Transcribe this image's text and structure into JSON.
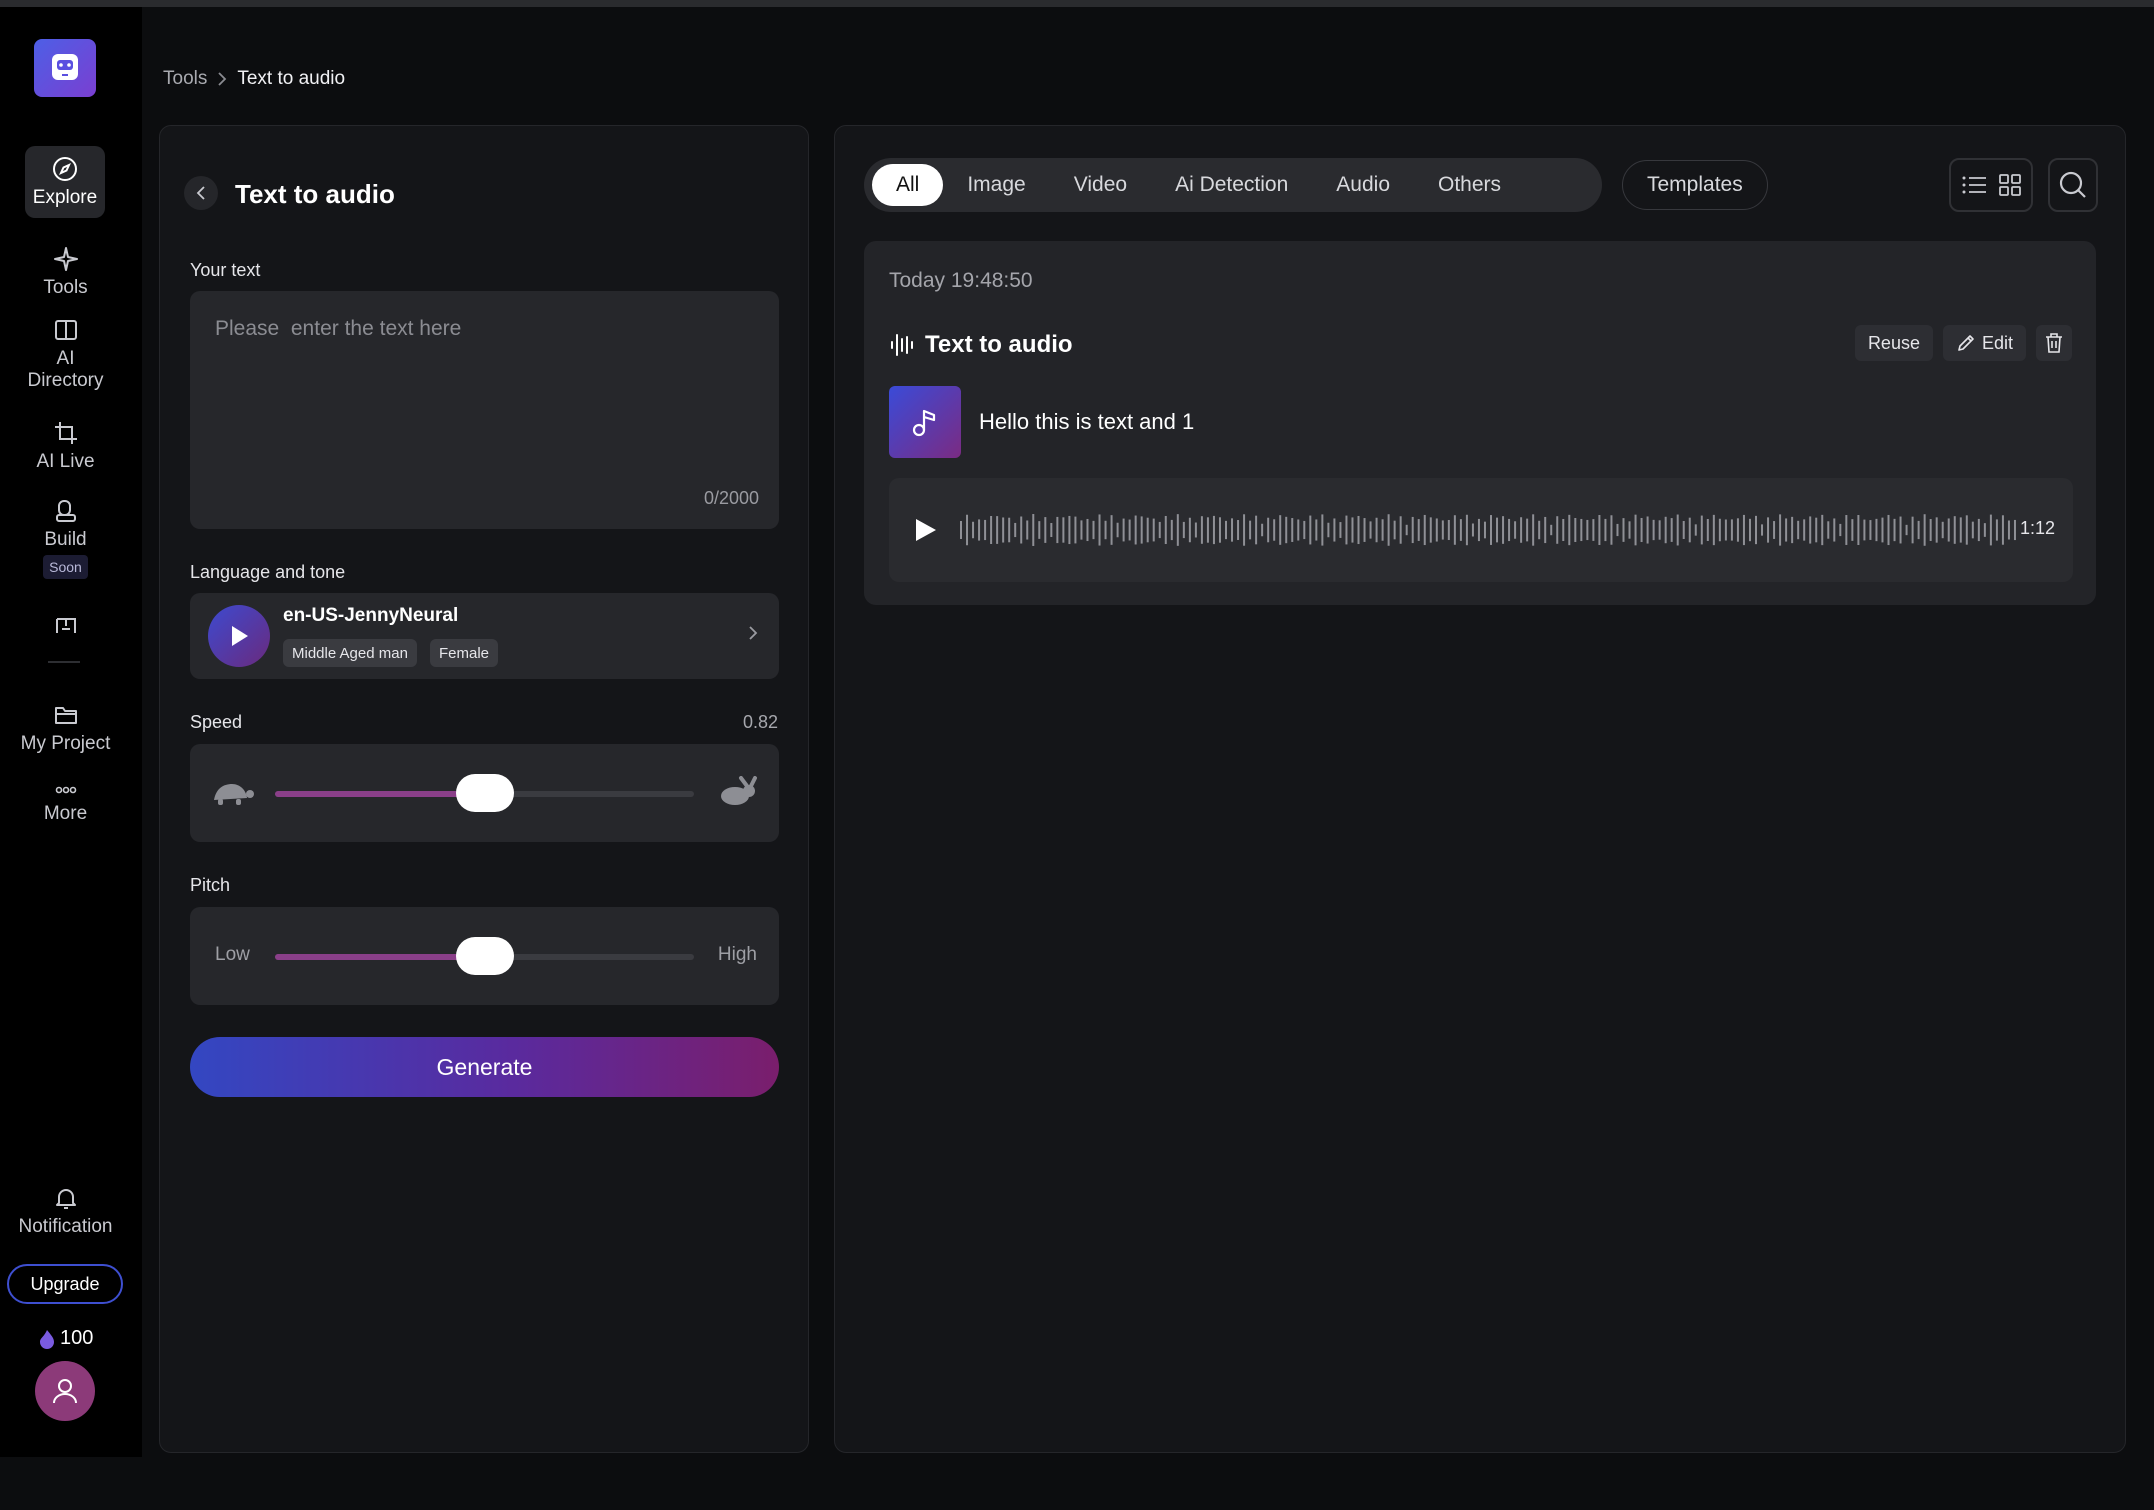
{
  "breadcrumb": {
    "parent": "Tools",
    "current": "Text to audio"
  },
  "sidebar": {
    "items": [
      {
        "label": "Explore"
      },
      {
        "label": "Tools"
      },
      {
        "label": "AI Directory"
      },
      {
        "label": "AI Live"
      },
      {
        "label": "Build",
        "badge": "Soon"
      },
      {
        "label": "My Project"
      },
      {
        "label": "More"
      },
      {
        "label": "Notification"
      }
    ],
    "upgrade_label": "Upgrade",
    "credits": "100"
  },
  "left_panel": {
    "title": "Text to audio",
    "text_label": "Your text",
    "text_placeholder": "Please  enter the text here",
    "char_count": "0/2000",
    "language_label": "Language and tone",
    "voice_name": "en-US-JennyNeural",
    "voice_tags": [
      "Middle Aged man",
      "Female"
    ],
    "speed_label": "Speed",
    "speed_value": "0.82",
    "speed_fill_fraction": 0.5,
    "pitch_label": "Pitch",
    "pitch_low": "Low",
    "pitch_high": "High",
    "pitch_fill_fraction": 0.5,
    "generate_label": "Generate"
  },
  "right_panel": {
    "tabs": [
      {
        "label": "All",
        "active": true
      },
      {
        "label": "Image",
        "active": false
      },
      {
        "label": "Video",
        "active": false
      },
      {
        "label": "Ai Detection",
        "active": false
      },
      {
        "label": "Audio",
        "active": false
      },
      {
        "label": "Others",
        "active": false
      }
    ],
    "templates_label": "Templates",
    "card": {
      "timestamp": "Today 19:48:50",
      "title": "Text to audio",
      "reuse_label": "Reuse",
      "edit_label": "Edit",
      "prompt": "Hello this is text and 1",
      "duration": "1:12"
    }
  },
  "colors": {
    "accent": "#3e4fd0",
    "slider_fill": "#8a3f89",
    "background": "#0c0d0f"
  }
}
